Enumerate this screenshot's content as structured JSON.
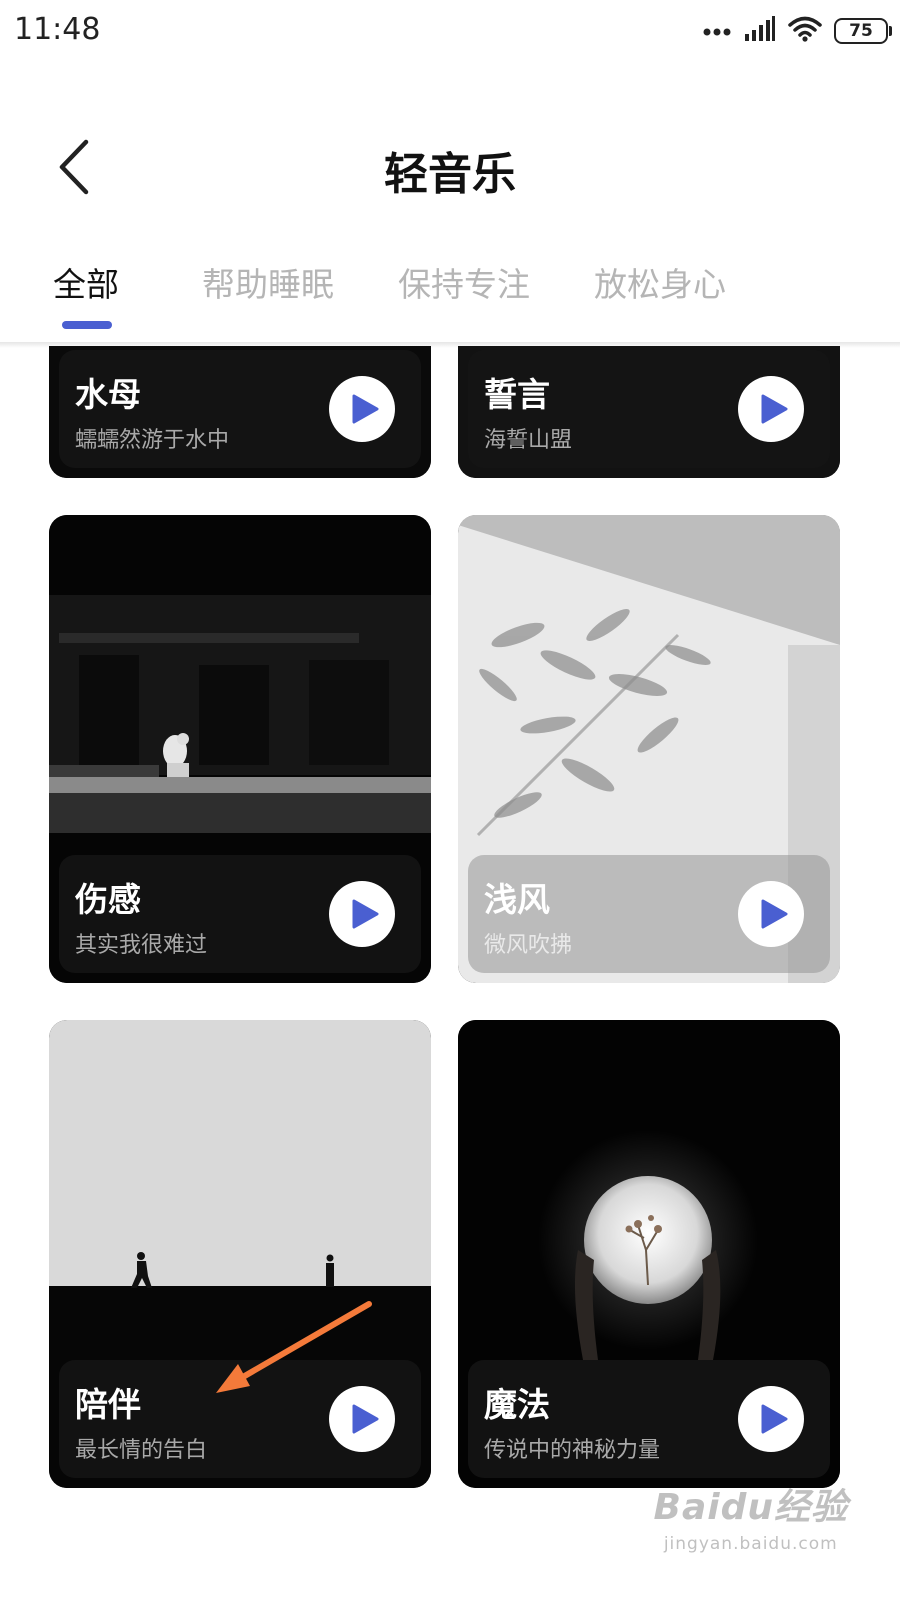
{
  "status_bar": {
    "time": "11:48",
    "battery": "75",
    "icons": [
      "more-dots-icon",
      "signal-icon",
      "wifi-icon",
      "battery-icon"
    ]
  },
  "header": {
    "title": "轻音乐",
    "back_icon": "chevron-left-icon"
  },
  "tabs": [
    {
      "label": "全部",
      "active": true
    },
    {
      "label": "帮助睡眠",
      "active": false
    },
    {
      "label": "保持专注",
      "active": false
    },
    {
      "label": "放松身心",
      "active": false
    }
  ],
  "accent_color": "#4a5fd1",
  "cards": [
    {
      "title": "水母",
      "subtitle": "蠕蠕然游于水中",
      "play_icon": "play-icon"
    },
    {
      "title": "誓言",
      "subtitle": "海誓山盟",
      "play_icon": "play-icon"
    },
    {
      "title": "伤感",
      "subtitle": "其实我很难过",
      "play_icon": "play-icon"
    },
    {
      "title": "浅风",
      "subtitle": "微风吹拂",
      "play_icon": "play-icon"
    },
    {
      "title": "陪伴",
      "subtitle": "最长情的告白",
      "play_icon": "play-icon"
    },
    {
      "title": "魔法",
      "subtitle": "传说中的神秘力量",
      "play_icon": "play-icon"
    }
  ],
  "annotation": {
    "arrow_color": "#f47a3a"
  },
  "watermark": {
    "logo": "Baidu经验",
    "url": "jingyan.baidu.com"
  }
}
